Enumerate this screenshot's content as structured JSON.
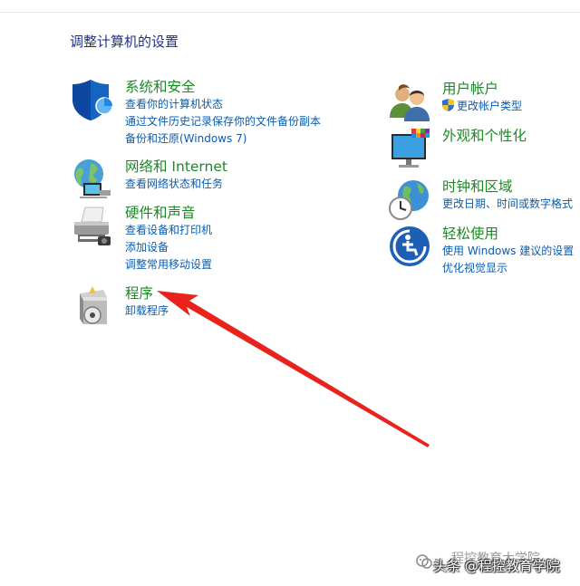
{
  "page": {
    "title": "调整计算机的设置"
  },
  "categories": {
    "system": {
      "title": "系统和安全",
      "links": [
        "查看你的计算机状态",
        "通过文件历史记录保存你的文件备份副本",
        "备份和还原(Windows 7)"
      ]
    },
    "network": {
      "title": "网络和 Internet",
      "links": [
        "查看网络状态和任务"
      ]
    },
    "hardware": {
      "title": "硬件和声音",
      "links": [
        "查看设备和打印机",
        "添加设备",
        "调整常用移动设置"
      ]
    },
    "programs": {
      "title": "程序",
      "links": [
        "卸载程序"
      ]
    },
    "accounts": {
      "title": "用户帐户",
      "links": [
        "更改帐户类型"
      ]
    },
    "appearance": {
      "title": "外观和个性化",
      "links": []
    },
    "clock": {
      "title": "时钟和区域",
      "links": [
        "更改日期、时间或数字格式"
      ]
    },
    "ease": {
      "title": "轻松使用",
      "links": [
        "使用 Windows 建议的设置",
        "优化视觉显示"
      ]
    }
  },
  "watermark": {
    "back_text": "程控教育大学院",
    "front_text": "头条 @程控教育学院"
  },
  "colors": {
    "title": "#1e3287",
    "category": "#1a8a24",
    "link": "#0b5cad",
    "arrow": "#e8231d"
  }
}
